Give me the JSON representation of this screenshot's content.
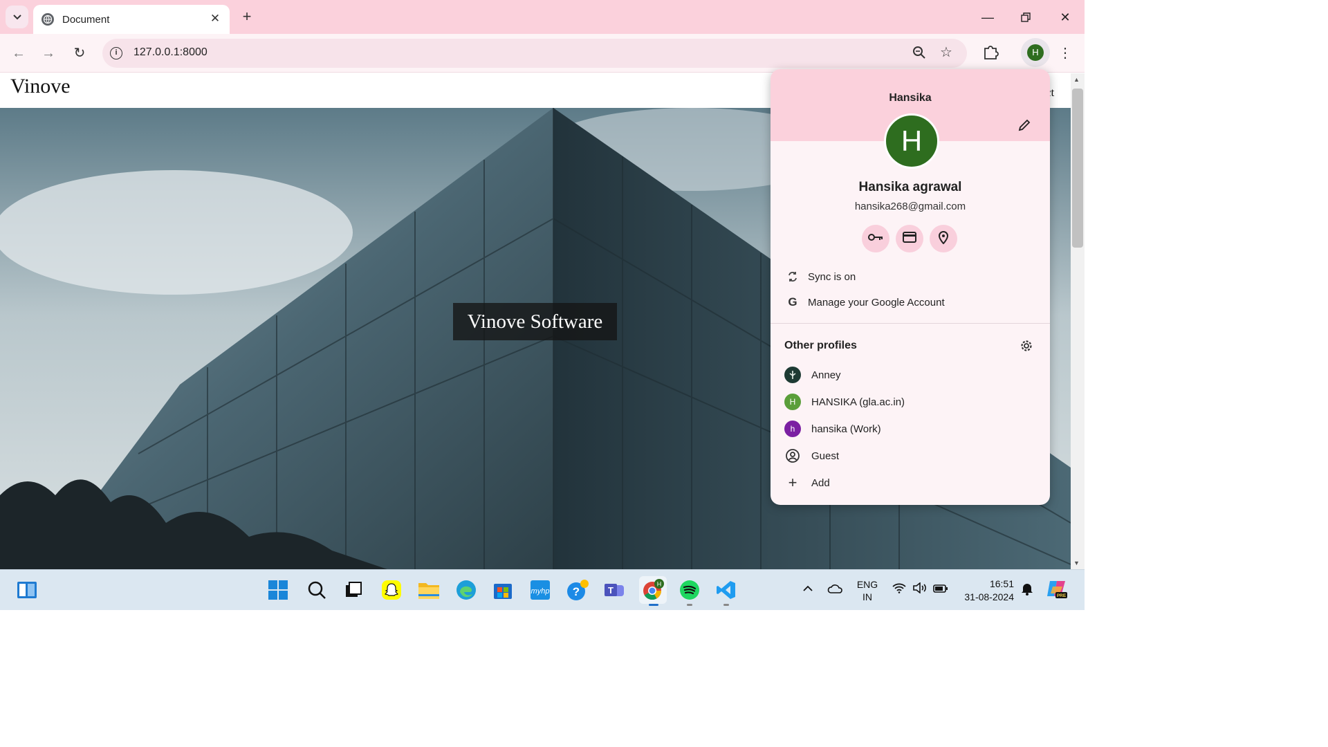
{
  "browser": {
    "tab_title": "Document",
    "url": "127.0.0.1:8000"
  },
  "page": {
    "site_name": "Vinove",
    "nav_fragment": "ct",
    "hero_title": "Vinove Software"
  },
  "profile_menu": {
    "profile_name": "Hansika",
    "avatar_letter": "H",
    "full_name": "Hansika agrawal",
    "email": "hansika268@gmail.com",
    "sync_label": "Sync is on",
    "manage_label": "Manage your Google Account",
    "other_profiles_title": "Other profiles",
    "profiles": [
      {
        "name": "Anney",
        "avatar": ""
      },
      {
        "name": "HANSIKA (gla.ac.in)",
        "avatar": "H"
      },
      {
        "name": "hansika (Work)",
        "avatar": "h"
      },
      {
        "name": "Guest",
        "avatar": ""
      }
    ],
    "add_label": "Add"
  },
  "taskbar": {
    "language": "ENG",
    "region": "IN",
    "time": "16:51",
    "date": "31-08-2024",
    "chrome_badge": "H"
  },
  "colors": {
    "titlebar": "#fbd1dc",
    "toolbar": "#fdf3f6",
    "avatar_green": "#2e6d1f",
    "work_purple": "#7b1fa2",
    "gla_green": "#5a9e3a",
    "taskbar": "#dbe7f1"
  },
  "icons": [
    "tab-search-icon",
    "globe-icon",
    "close-icon",
    "plus-icon",
    "minimize-icon",
    "restore-icon",
    "window-close-icon",
    "back-icon",
    "forward-icon",
    "reload-icon",
    "info-icon",
    "zoom-icon",
    "star-icon",
    "extensions-icon",
    "more-icon",
    "edit-icon",
    "key-icon",
    "card-icon",
    "location-icon",
    "sync-icon",
    "google-icon",
    "gear-icon",
    "guest-icon",
    "add-icon"
  ]
}
